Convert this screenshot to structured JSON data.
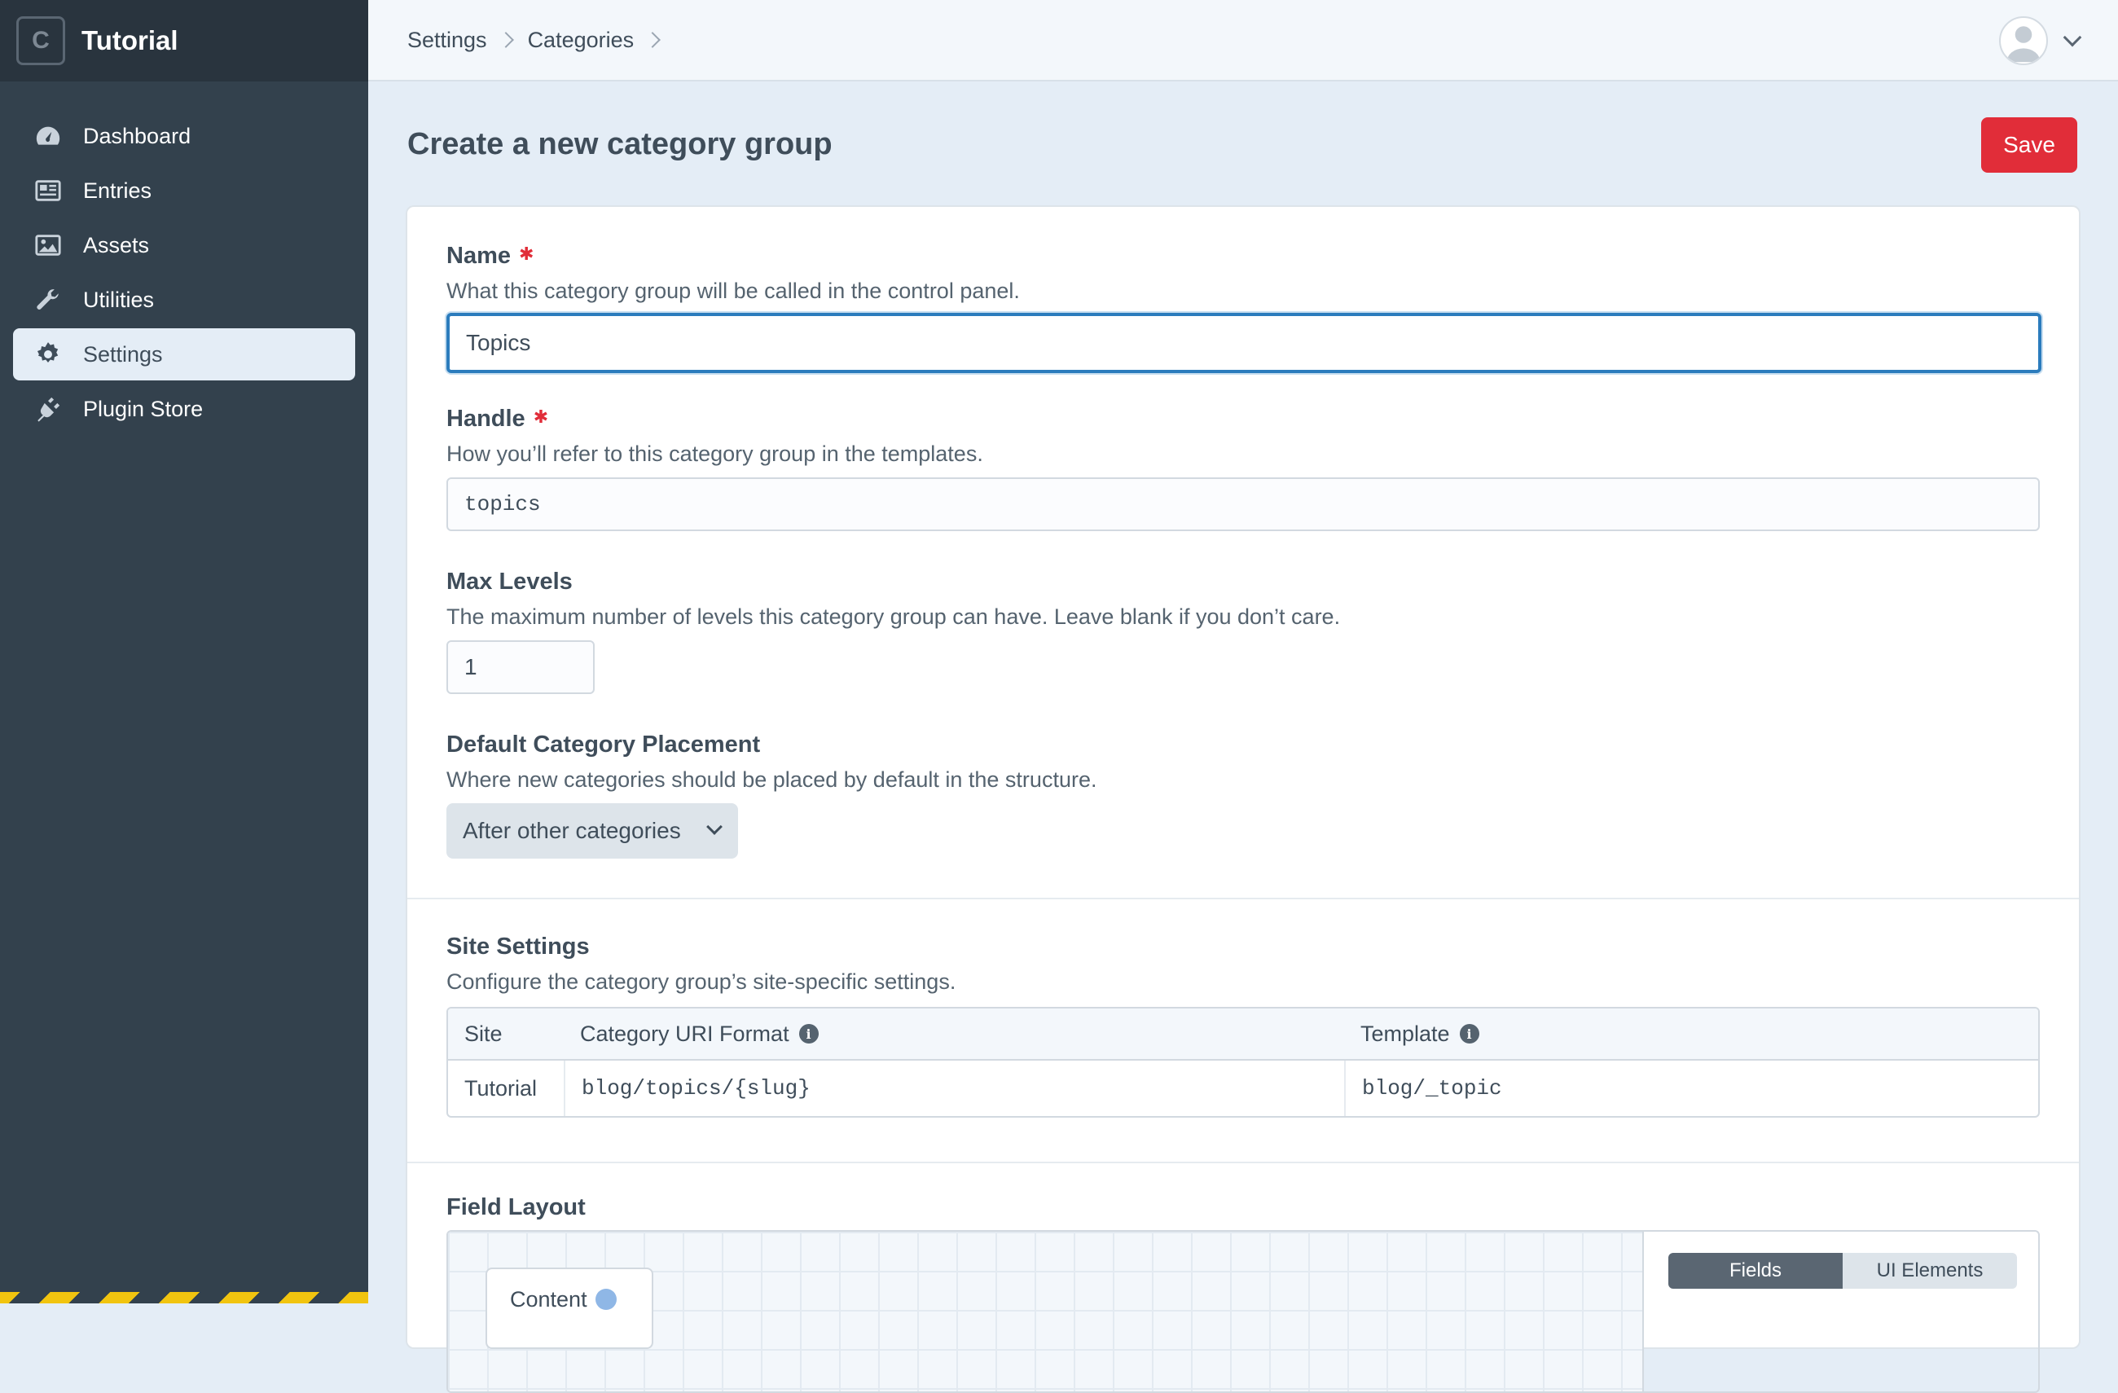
{
  "site": {
    "name": "Tutorial",
    "logo_letter": "C"
  },
  "nav": {
    "items": [
      {
        "label": "Dashboard",
        "icon": "dashboard-icon"
      },
      {
        "label": "Entries",
        "icon": "newspaper-icon"
      },
      {
        "label": "Assets",
        "icon": "image-icon"
      },
      {
        "label": "Utilities",
        "icon": "wrench-icon"
      },
      {
        "label": "Settings",
        "icon": "gear-icon",
        "active": true
      },
      {
        "label": "Plugin Store",
        "icon": "plug-icon"
      }
    ]
  },
  "breadcrumbs": [
    "Settings",
    "Categories"
  ],
  "page": {
    "title": "Create a new category group",
    "save_label": "Save"
  },
  "fields": {
    "name": {
      "label": "Name",
      "description": "What this category group will be called in the control panel.",
      "value": "Topics"
    },
    "handle": {
      "label": "Handle",
      "description": "How you’ll refer to this category group in the templates.",
      "value": "topics"
    },
    "max_levels": {
      "label": "Max Levels",
      "description": "The maximum number of levels this category group can have. Leave blank if you don’t care.",
      "value": "1"
    },
    "placement": {
      "label": "Default Category Placement",
      "description": "Where new categories should be placed by default in the structure.",
      "value": "After other categories"
    }
  },
  "site_settings": {
    "label": "Site Settings",
    "description": "Configure the category group’s site-specific settings.",
    "columns": [
      "Site",
      "Category URI Format",
      "Template"
    ],
    "rows": [
      {
        "site": "Tutorial",
        "uri_format": "blog/topics/{slug}",
        "template": "blog/_topic"
      }
    ]
  },
  "field_layout": {
    "label": "Field Layout",
    "tab_name": "Content",
    "tabs": [
      "Fields",
      "UI Elements"
    ]
  },
  "colors": {
    "accent_red": "#e12d39",
    "focus_blue": "#2b7cbd",
    "sidebar": "#33414d"
  }
}
